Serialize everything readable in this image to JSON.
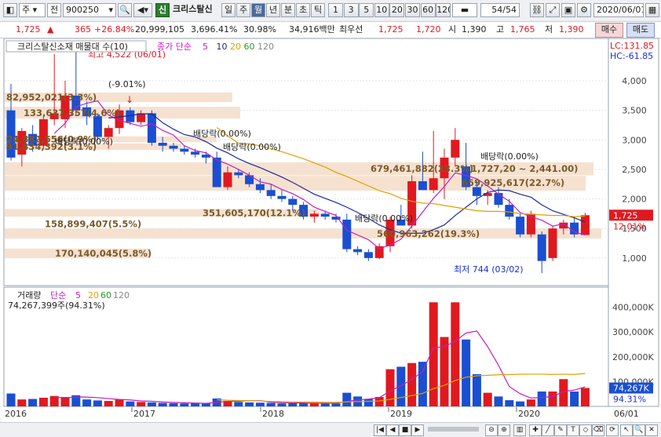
{
  "toolbar": {
    "type_label": "주",
    "market_label": "전",
    "code": "900250",
    "badge": "신",
    "stock_name": "크리스탈신",
    "periods": [
      "일",
      "주",
      "월",
      "년",
      "분",
      "초",
      "틱"
    ],
    "active_period": "월",
    "numbers": [
      "1",
      "3",
      "5",
      "10",
      "20",
      "30",
      "60",
      "120"
    ],
    "page": "54",
    "page_total": "/54",
    "date": "2020/06/01"
  },
  "quote": {
    "price": "1,725",
    "change": "365",
    "change_pct": "+26.84%",
    "volume": "20,999,105",
    "volume_ratio": "3,696.41%",
    "turnover": "30.98%",
    "amount": "34,916백만",
    "best_label": "최우선",
    "best_ask": "1,725",
    "best_bid": "1,720",
    "open_label": "시",
    "open": "1,390",
    "high_label": "고",
    "high": "1,765",
    "low_label": "저",
    "low": "1,390",
    "buy_label": "매수",
    "sell_label": "매도"
  },
  "colors": {
    "up": "#e0191f",
    "down": "#1a4fd1",
    "ma5": "#c020c0",
    "ma10": "#1a2a9a",
    "ma20": "#e0a000",
    "band": "#f6e1cf"
  },
  "price_panel": {
    "legend_title": "크리스탈신소재 매물대 수(10)",
    "legend_ma": "종가 단순",
    "ma_periods": [
      "5",
      "10",
      "20",
      "60",
      "120"
    ],
    "lc": "LC:131.85",
    "hc": "HC:-61.85",
    "last_price": "1,725",
    "last_pct": "12.01%",
    "axis_ticks": [
      4000,
      3500,
      3000,
      2500,
      2000,
      1500,
      1000
    ],
    "high_marker": "최고 4,522 (06/01)",
    "low_marker": "최저 744 (03/02)",
    "drop_label": "(-9.01%)",
    "dividend_label": "배당락(0.00%)",
    "band_labels": [
      "82,952,021(3.3%)",
      "133,637,357(4.6%)",
      "24,882,556(0.9%)",
      "91,834,392(3.1%)",
      "679,461,882(23.3%)",
      "1,727,20 ~ 2,441.00)",
      "659,925,617(22.7%)",
      "351,605,170(12.1%)",
      "158,899,407(5.5%)",
      "560,963,262(19.3%)",
      "170,140,045(5.8%)"
    ]
  },
  "volume_panel": {
    "legend_title": "거래량",
    "legend_ma": "단순",
    "ma_periods": [
      "5",
      "20",
      "60",
      "120"
    ],
    "summary": "74,267,399주(94.31%)",
    "last_value": "74,267K",
    "last_pct": "94.31%",
    "axis_ticks": [
      "400,000K",
      "300,000K",
      "200,000K",
      "100,000K"
    ]
  },
  "x_axis": {
    "labels": [
      "2016",
      "2017",
      "2018",
      "2019",
      "2020",
      "06/01"
    ]
  },
  "chart_data": {
    "type": "candlestick",
    "note_units": "price in KRW, volume in thousands of shares",
    "candles": [
      {
        "o": 3500,
        "h": 3950,
        "l": 2650,
        "c": 2700
      },
      {
        "o": 2750,
        "h": 3200,
        "l": 2550,
        "c": 3150
      },
      {
        "o": 3100,
        "h": 3250,
        "l": 2800,
        "c": 2900
      },
      {
        "o": 2900,
        "h": 3400,
        "l": 2850,
        "c": 3350
      },
      {
        "o": 3350,
        "h": 4450,
        "l": 3250,
        "c": 3450
      },
      {
        "o": 3350,
        "h": 4000,
        "l": 3200,
        "c": 3750
      },
      {
        "o": 3750,
        "h": 4522,
        "l": 3400,
        "c": 3500
      },
      {
        "o": 3550,
        "h": 3650,
        "l": 3250,
        "c": 3400
      },
      {
        "o": 3400,
        "h": 3450,
        "l": 3000,
        "c": 3050
      },
      {
        "o": 3050,
        "h": 3250,
        "l": 2850,
        "c": 3200
      },
      {
        "o": 3200,
        "h": 3600,
        "l": 3100,
        "c": 3500
      },
      {
        "o": 3500,
        "h": 3550,
        "l": 3250,
        "c": 3300
      },
      {
        "o": 3300,
        "h": 3500,
        "l": 3250,
        "c": 3450
      },
      {
        "o": 3450,
        "h": 3500,
        "l": 2900,
        "c": 2950
      },
      {
        "o": 2950,
        "h": 3050,
        "l": 2800,
        "c": 2900
      },
      {
        "o": 2900,
        "h": 2950,
        "l": 2800,
        "c": 2850
      },
      {
        "o": 2850,
        "h": 2900,
        "l": 2750,
        "c": 2800
      },
      {
        "o": 2800,
        "h": 2850,
        "l": 2700,
        "c": 2750
      },
      {
        "o": 2750,
        "h": 2800,
        "l": 2600,
        "c": 2700
      },
      {
        "o": 2700,
        "h": 2800,
        "l": 2350,
        "c": 2200
      },
      {
        "o": 2200,
        "h": 2550,
        "l": 2150,
        "c": 2450
      },
      {
        "o": 2450,
        "h": 2500,
        "l": 2350,
        "c": 2400
      },
      {
        "o": 2400,
        "h": 2450,
        "l": 2200,
        "c": 2250
      },
      {
        "o": 2250,
        "h": 2350,
        "l": 2100,
        "c": 2150
      },
      {
        "o": 2150,
        "h": 2250,
        "l": 2000,
        "c": 2050
      },
      {
        "o": 2050,
        "h": 2150,
        "l": 1950,
        "c": 2000
      },
      {
        "o": 2000,
        "h": 2050,
        "l": 1800,
        "c": 1900
      },
      {
        "o": 1900,
        "h": 1950,
        "l": 1650,
        "c": 1700
      },
      {
        "o": 1700,
        "h": 1800,
        "l": 1600,
        "c": 1750
      },
      {
        "o": 1750,
        "h": 1800,
        "l": 1650,
        "c": 1700
      },
      {
        "o": 1700,
        "h": 1750,
        "l": 1600,
        "c": 1650
      },
      {
        "o": 1650,
        "h": 1750,
        "l": 1100,
        "c": 1150
      },
      {
        "o": 1150,
        "h": 1200,
        "l": 1050,
        "c": 1100
      },
      {
        "o": 1100,
        "h": 1150,
        "l": 950,
        "c": 1000
      },
      {
        "o": 1000,
        "h": 1250,
        "l": 980,
        "c": 1200
      },
      {
        "o": 1200,
        "h": 1700,
        "l": 1100,
        "c": 1650
      },
      {
        "o": 1650,
        "h": 1900,
        "l": 1550,
        "c": 1550
      },
      {
        "o": 1550,
        "h": 2400,
        "l": 1500,
        "c": 2300
      },
      {
        "o": 2300,
        "h": 2800,
        "l": 2200,
        "c": 2150
      },
      {
        "o": 2150,
        "h": 3150,
        "l": 2100,
        "c": 2350
      },
      {
        "o": 2350,
        "h": 2850,
        "l": 2000,
        "c": 2700
      },
      {
        "o": 2700,
        "h": 3200,
        "l": 2550,
        "c": 3000
      },
      {
        "o": 2550,
        "h": 2950,
        "l": 2150,
        "c": 2200
      },
      {
        "o": 2200,
        "h": 2300,
        "l": 1900,
        "c": 2050
      },
      {
        "o": 2050,
        "h": 2150,
        "l": 1900,
        "c": 2100
      },
      {
        "o": 2100,
        "h": 2200,
        "l": 1850,
        "c": 1900
      },
      {
        "o": 1900,
        "h": 2000,
        "l": 1650,
        "c": 1700
      },
      {
        "o": 1700,
        "h": 1750,
        "l": 1350,
        "c": 1400
      },
      {
        "o": 1400,
        "h": 1800,
        "l": 1350,
        "c": 1750
      },
      {
        "o": 1400,
        "h": 1450,
        "l": 744,
        "c": 950
      },
      {
        "o": 1000,
        "h": 1550,
        "l": 950,
        "c": 1500
      },
      {
        "o": 1500,
        "h": 1650,
        "l": 1400,
        "c": 1600
      },
      {
        "o": 1600,
        "h": 1700,
        "l": 1350,
        "c": 1400
      },
      {
        "o": 1390,
        "h": 1765,
        "l": 1390,
        "c": 1725
      }
    ],
    "volume": [
      52000,
      28000,
      30000,
      35000,
      42000,
      38000,
      45000,
      28000,
      24000,
      22000,
      27000,
      20000,
      18000,
      16000,
      14000,
      13000,
      12000,
      12500,
      12000,
      32000,
      22000,
      18000,
      16000,
      15000,
      14000,
      12000,
      13000,
      14000,
      12000,
      11000,
      12000,
      55000,
      40000,
      30000,
      38000,
      150000,
      160000,
      175000,
      180000,
      420000,
      280000,
      420000,
      270000,
      130000,
      55000,
      40000,
      25000,
      20000,
      28000,
      60000,
      60000,
      110000,
      60000,
      74267
    ],
    "ma5": [
      null,
      null,
      null,
      null,
      3110,
      3280,
      3560,
      3620,
      3660,
      3420,
      3330,
      3280,
      3230,
      3270,
      3160,
      3080,
      2900,
      2820,
      2780,
      2660,
      2590,
      2500,
      2400,
      2290,
      2250,
      2160,
      2090,
      1990,
      1860,
      1790,
      1720,
      1470,
      1390,
      1310,
      1160,
      1220,
      1320,
      1540,
      1780,
      2010,
      2210,
      2440,
      2400,
      2340,
      2220,
      2080,
      1960,
      1770,
      1700,
      1640,
      1540,
      1580,
      1440,
      1390
    ],
    "ma10": [
      null,
      null,
      null,
      null,
      null,
      null,
      null,
      null,
      null,
      3370,
      3390,
      3410,
      3440,
      3440,
      3290,
      3180,
      3090,
      3050,
      2970,
      2860,
      2780,
      2680,
      2600,
      2530,
      2450,
      2370,
      2280,
      2180,
      2080,
      2010,
      1940,
      1860,
      1770,
      1670,
      1560,
      1480,
      1420,
      1420,
      1420,
      1480,
      1560,
      1720,
      1860,
      2000,
      2110,
      2150,
      2140,
      2080,
      2030,
      1900,
      1800,
      1740,
      1680,
      1610
    ],
    "ma20": [
      null,
      null,
      null,
      null,
      null,
      null,
      null,
      null,
      null,
      null,
      null,
      null,
      null,
      null,
      null,
      null,
      null,
      null,
      null,
      3210,
      3070,
      2940,
      2930,
      2900,
      2850,
      2800,
      2740,
      2680,
      2610,
      2540,
      2450,
      2380,
      2300,
      2220,
      2140,
      2090,
      2010,
      1960,
      1930,
      1920,
      1890,
      1860,
      1830,
      1800,
      1790,
      1790,
      1780,
      1750,
      1740,
      1730,
      1720,
      1720,
      1700,
      1710
    ],
    "vma5": [
      null,
      null,
      null,
      null,
      37400,
      34600,
      38000,
      37600,
      35400,
      31400,
      28200,
      26200,
      22200,
      20600,
      17800,
      16200,
      14600,
      13500,
      12300,
      16300,
      20300,
      21300,
      22800,
      23200,
      17000,
      15000,
      14000,
      13800,
      13000,
      12800,
      12400,
      20800,
      26000,
      29600,
      35000,
      62600,
      83600,
      108600,
      140600,
      237000,
      241000,
      262600,
      296000,
      304000,
      241000,
      166000,
      80000,
      51200,
      33600,
      36000,
      40000,
      60000,
      66000,
      79000
    ],
    "vma20": [
      null,
      null,
      null,
      null,
      null,
      null,
      null,
      null,
      null,
      null,
      null,
      null,
      null,
      null,
      null,
      null,
      null,
      null,
      null,
      27000,
      25000,
      24000,
      23000,
      22000,
      20000,
      19000,
      18000,
      17500,
      17000,
      16500,
      16500,
      18000,
      19500,
      20500,
      22000,
      28500,
      35800,
      44000,
      52300,
      72000,
      85000,
      104500,
      117700,
      123500,
      125500,
      127700,
      128300,
      129700,
      130000,
      130000,
      129000,
      130000,
      129000,
      133000
    ]
  }
}
